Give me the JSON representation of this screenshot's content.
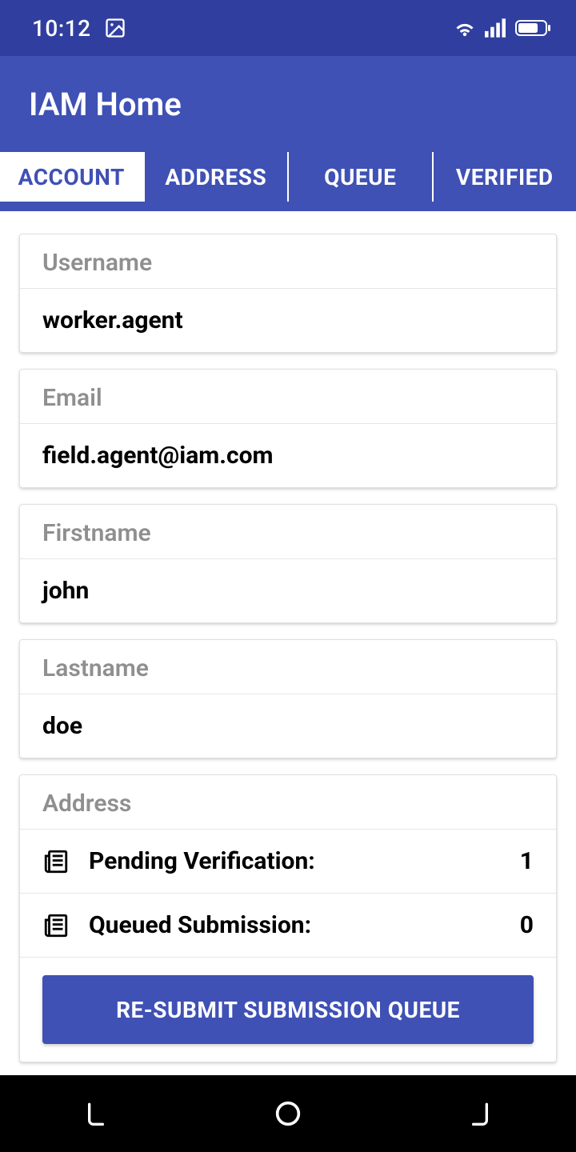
{
  "status": {
    "time": "10:12"
  },
  "appbar": {
    "title": "IAM Home"
  },
  "tabs": [
    {
      "label": "ACCOUNT",
      "active": true
    },
    {
      "label": "ADDRESS",
      "active": false
    },
    {
      "label": "QUEUE",
      "active": false
    },
    {
      "label": "VERIFIED",
      "active": false
    }
  ],
  "fields": {
    "username": {
      "label": "Username",
      "value": "worker.agent"
    },
    "email": {
      "label": "Email",
      "value": "field.agent@iam.com"
    },
    "firstname": {
      "label": "Firstname",
      "value": "john"
    },
    "lastname": {
      "label": "Lastname",
      "value": "doe"
    }
  },
  "address": {
    "label": "Address",
    "pending": {
      "label": "Pending Verification:",
      "value": "1"
    },
    "queued": {
      "label": "Queued Submission:",
      "value": "0"
    },
    "resubmit_label": "RE-SUBMIT SUBMISSION QUEUE"
  }
}
